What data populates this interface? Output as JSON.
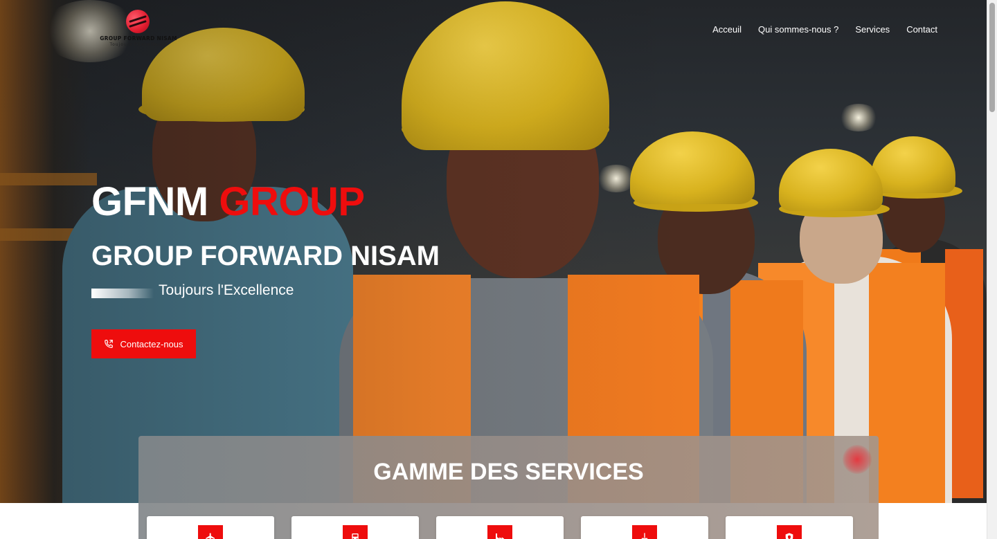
{
  "header": {
    "logo_name": "GROUP FORWARD NISAM",
    "logo_tagline": "Toujours l'Excellence",
    "nav": [
      "Acceuil",
      "Qui sommes-nous ?",
      "Services",
      "Contact"
    ]
  },
  "hero": {
    "brand_primary": "GFNM",
    "brand_accent": "GROUP",
    "title": "GROUP FORWARD NISAM",
    "subtitle": "Toujours l'Excellence",
    "cta_label": "Contactez-nous",
    "cta_icon": "phone-icon"
  },
  "services": {
    "title": "GAMME DES SERVICES",
    "cards": [
      {
        "icon": "plane-icon"
      },
      {
        "icon": "truck-icon"
      },
      {
        "icon": "factory-icon"
      },
      {
        "icon": "cleaning-icon"
      },
      {
        "icon": "shield-icon"
      }
    ]
  },
  "colors": {
    "accent": "#ee0d0d",
    "panel": "#8f8c89",
    "white": "#ffffff"
  }
}
